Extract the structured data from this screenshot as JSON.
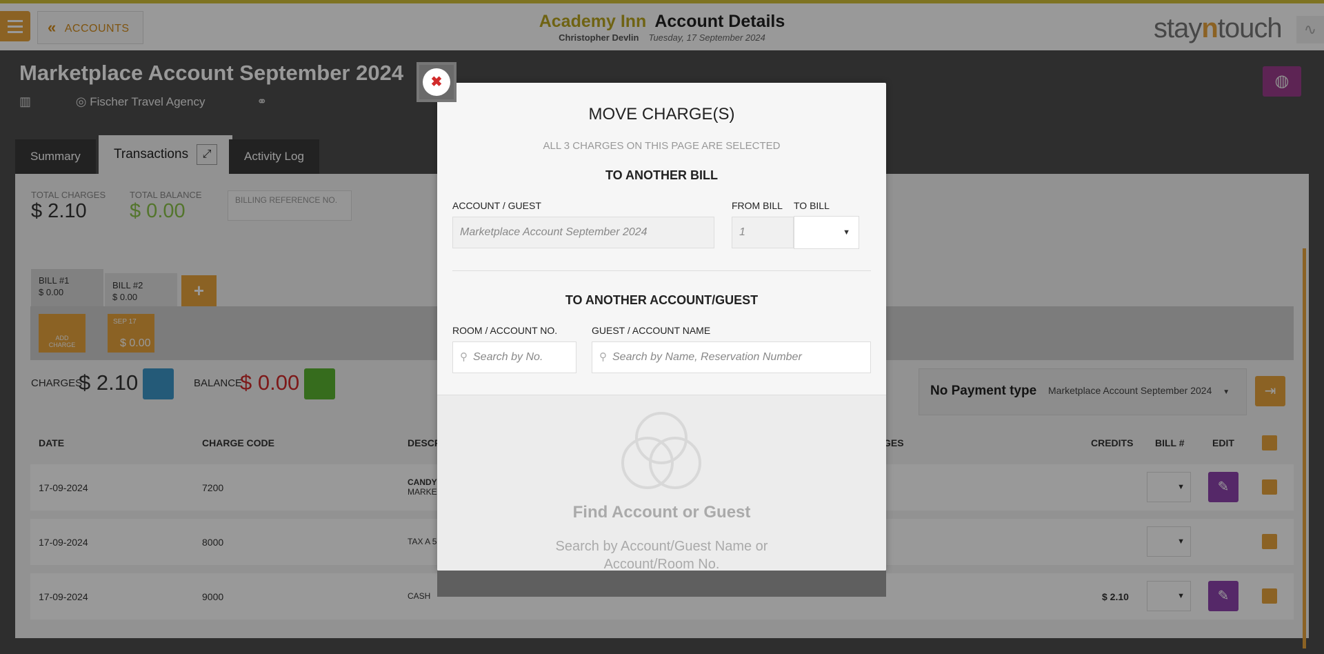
{
  "header": {
    "back_label": "ACCOUNTS",
    "hotel": "Academy Inn",
    "title": "Account Details",
    "user": "Christopher Devlin",
    "date": "Tuesday, 17 September 2024",
    "logo_a": "stay",
    "logo_n": "n",
    "logo_b": "touch"
  },
  "account": {
    "title": "Marketplace Account September 2024",
    "agency": "Fischer Travel Agency"
  },
  "tabs": [
    {
      "label": "Summary"
    },
    {
      "label": "Transactions"
    },
    {
      "label": "Activity Log"
    }
  ],
  "totals": {
    "charges_label": "TOTAL CHARGES",
    "charges_value": "$ 2.10",
    "balance_label": "TOTAL BALANCE",
    "balance_value": "$ 0.00",
    "billing_ref_label": "BILLING REFERENCE NO."
  },
  "bills": [
    {
      "label": "BILL #1",
      "amount": "$ 0.00"
    },
    {
      "label": "BILL #2",
      "amount": "$ 0.00"
    }
  ],
  "add_bill": "+",
  "add_charge_label_1": "ADD",
  "add_charge_label_2": "CHARGE",
  "date_card": {
    "date": "SEP 17",
    "amount": "$ 0.00"
  },
  "summary_row": {
    "charges_label": "CHARGES",
    "charges_value": "$ 2.10",
    "balance_label": "BALANCE",
    "balance_value": "$ 0.00"
  },
  "payment": {
    "label": "No Payment type",
    "selected": "Marketplace Account September 2024"
  },
  "table": {
    "headers": {
      "date": "DATE",
      "charge_code": "CHARGE CODE",
      "description": "DESCR",
      "charges": "GES",
      "credits": "CREDITS",
      "bill": "BILL #",
      "edit": "EDIT"
    },
    "rows": [
      {
        "date": "17-09-2024",
        "code": "7200",
        "desc1": "CANDY",
        "desc2": "MARKE",
        "credits": ""
      },
      {
        "date": "17-09-2024",
        "code": "8000",
        "desc1": "TAX A 5",
        "desc2": "",
        "credits": ""
      },
      {
        "date": "17-09-2024",
        "code": "9000",
        "desc1": "CASH",
        "desc2": "",
        "credits": "$ 2.10"
      }
    ]
  },
  "modal": {
    "title": "MOVE CHARGE(S)",
    "subtitle": "ALL 3 CHARGES ON THIS PAGE ARE SELECTED",
    "section1": "TO ANOTHER BILL",
    "account_guest_label": "ACCOUNT / GUEST",
    "account_guest_value": "Marketplace Account September 2024",
    "from_bill_label": "FROM BILL",
    "from_bill_value": "1",
    "to_bill_label": "TO BILL",
    "section2": "TO ANOTHER ACCOUNT/GUEST",
    "room_label": "ROOM / ACCOUNT NO.",
    "room_placeholder": "Search by No.",
    "guest_label": "GUEST / ACCOUNT NAME",
    "guest_placeholder": "Search by Name, Reservation Number",
    "find_title": "Find Account or Guest",
    "find_sub_1": "Search by Account/Guest Name or",
    "find_sub_2": "Account/Room No."
  },
  "colors": {
    "accent": "#e8a33c",
    "hotel": "#b9a620",
    "edit": "#8e44ad",
    "balance_red": "#d12b2b",
    "balance_green": "#8bc34a"
  }
}
